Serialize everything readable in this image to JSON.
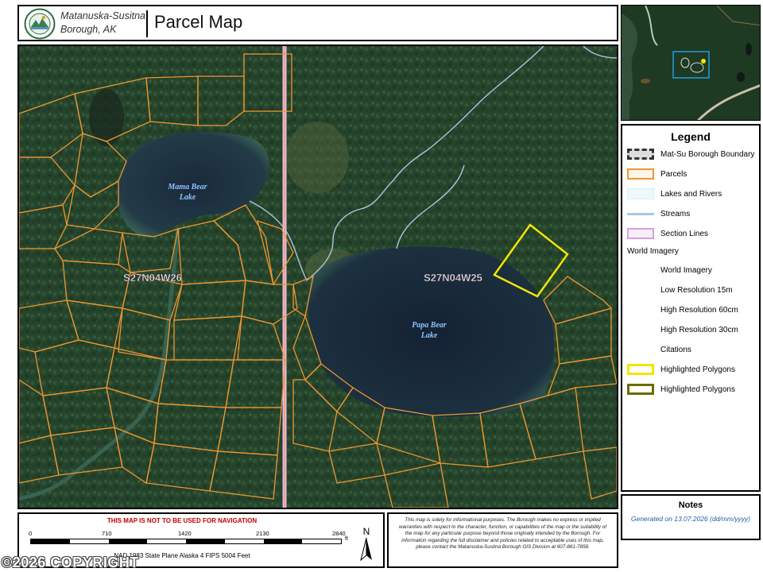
{
  "header": {
    "org_line1": "Matanuska-Susitna",
    "org_line2": "Borough, AK",
    "title": "Parcel Map"
  },
  "map": {
    "section_labels": [
      "S27N04W26",
      "S27N04W25"
    ],
    "lake_labels": [
      {
        "line1": "Mama Bear",
        "line2": "Lake"
      },
      {
        "line1": "Papa Bear",
        "line2": "Lake"
      }
    ],
    "colors": {
      "parcel": "#f0962e",
      "section_line": "#e8b8e8",
      "highlight": "#f2e600",
      "stream": "#a9c8e0",
      "lake_label": "#8fc3ff"
    }
  },
  "legend": {
    "title": "Legend",
    "items": [
      {
        "label": "Mat-Su Borough Boundary",
        "icon": "dashed-boundary"
      },
      {
        "label": "Parcels",
        "icon": "orange-outline"
      },
      {
        "label": "Lakes and Rivers",
        "icon": "light-blue-fill"
      },
      {
        "label": "Streams",
        "icon": "blue-line"
      },
      {
        "label": "Section Lines",
        "icon": "pink-outline"
      }
    ],
    "group_label": "World Imagery",
    "sub_items": [
      "World Imagery",
      "Low Resolution 15m",
      "High Resolution 60cm",
      "High Resolution 30cm",
      "Citations"
    ],
    "highlight_items": [
      {
        "label": "Highlighted Polygons",
        "color": "#f2e600"
      },
      {
        "label": "Highlighted Polygons",
        "color": "#6b6b00"
      }
    ]
  },
  "notes": {
    "title": "Notes",
    "generated_label": "Generated on",
    "generated_date": "13.07.2026",
    "date_format": "(dd/mm/yyyy)"
  },
  "scale": {
    "warning": "THIS MAP IS NOT TO BE USED FOR NAVIGATION",
    "ticks": [
      "0",
      "710",
      "1420",
      "2130",
      "2840"
    ],
    "unit": "ft",
    "projection": "NAD 1983 State Plane Alaska 4 FIPS 5004 Feet",
    "north_label": "N"
  },
  "disclaimer": "This map is solely for informational purposes. The Borough makes no express or implied warranties with respect to the character, function, or capabilities of the map or the suitability of the map for any particular purpose beyond those originally intended by the Borough. For information regarding the full disclaimer and policies related to acceptable uses of this map, please contact the Matanuska-Susitna Borough GIS Division at 907-861-7858.",
  "watermark": "©2026 COPYRIGHT"
}
